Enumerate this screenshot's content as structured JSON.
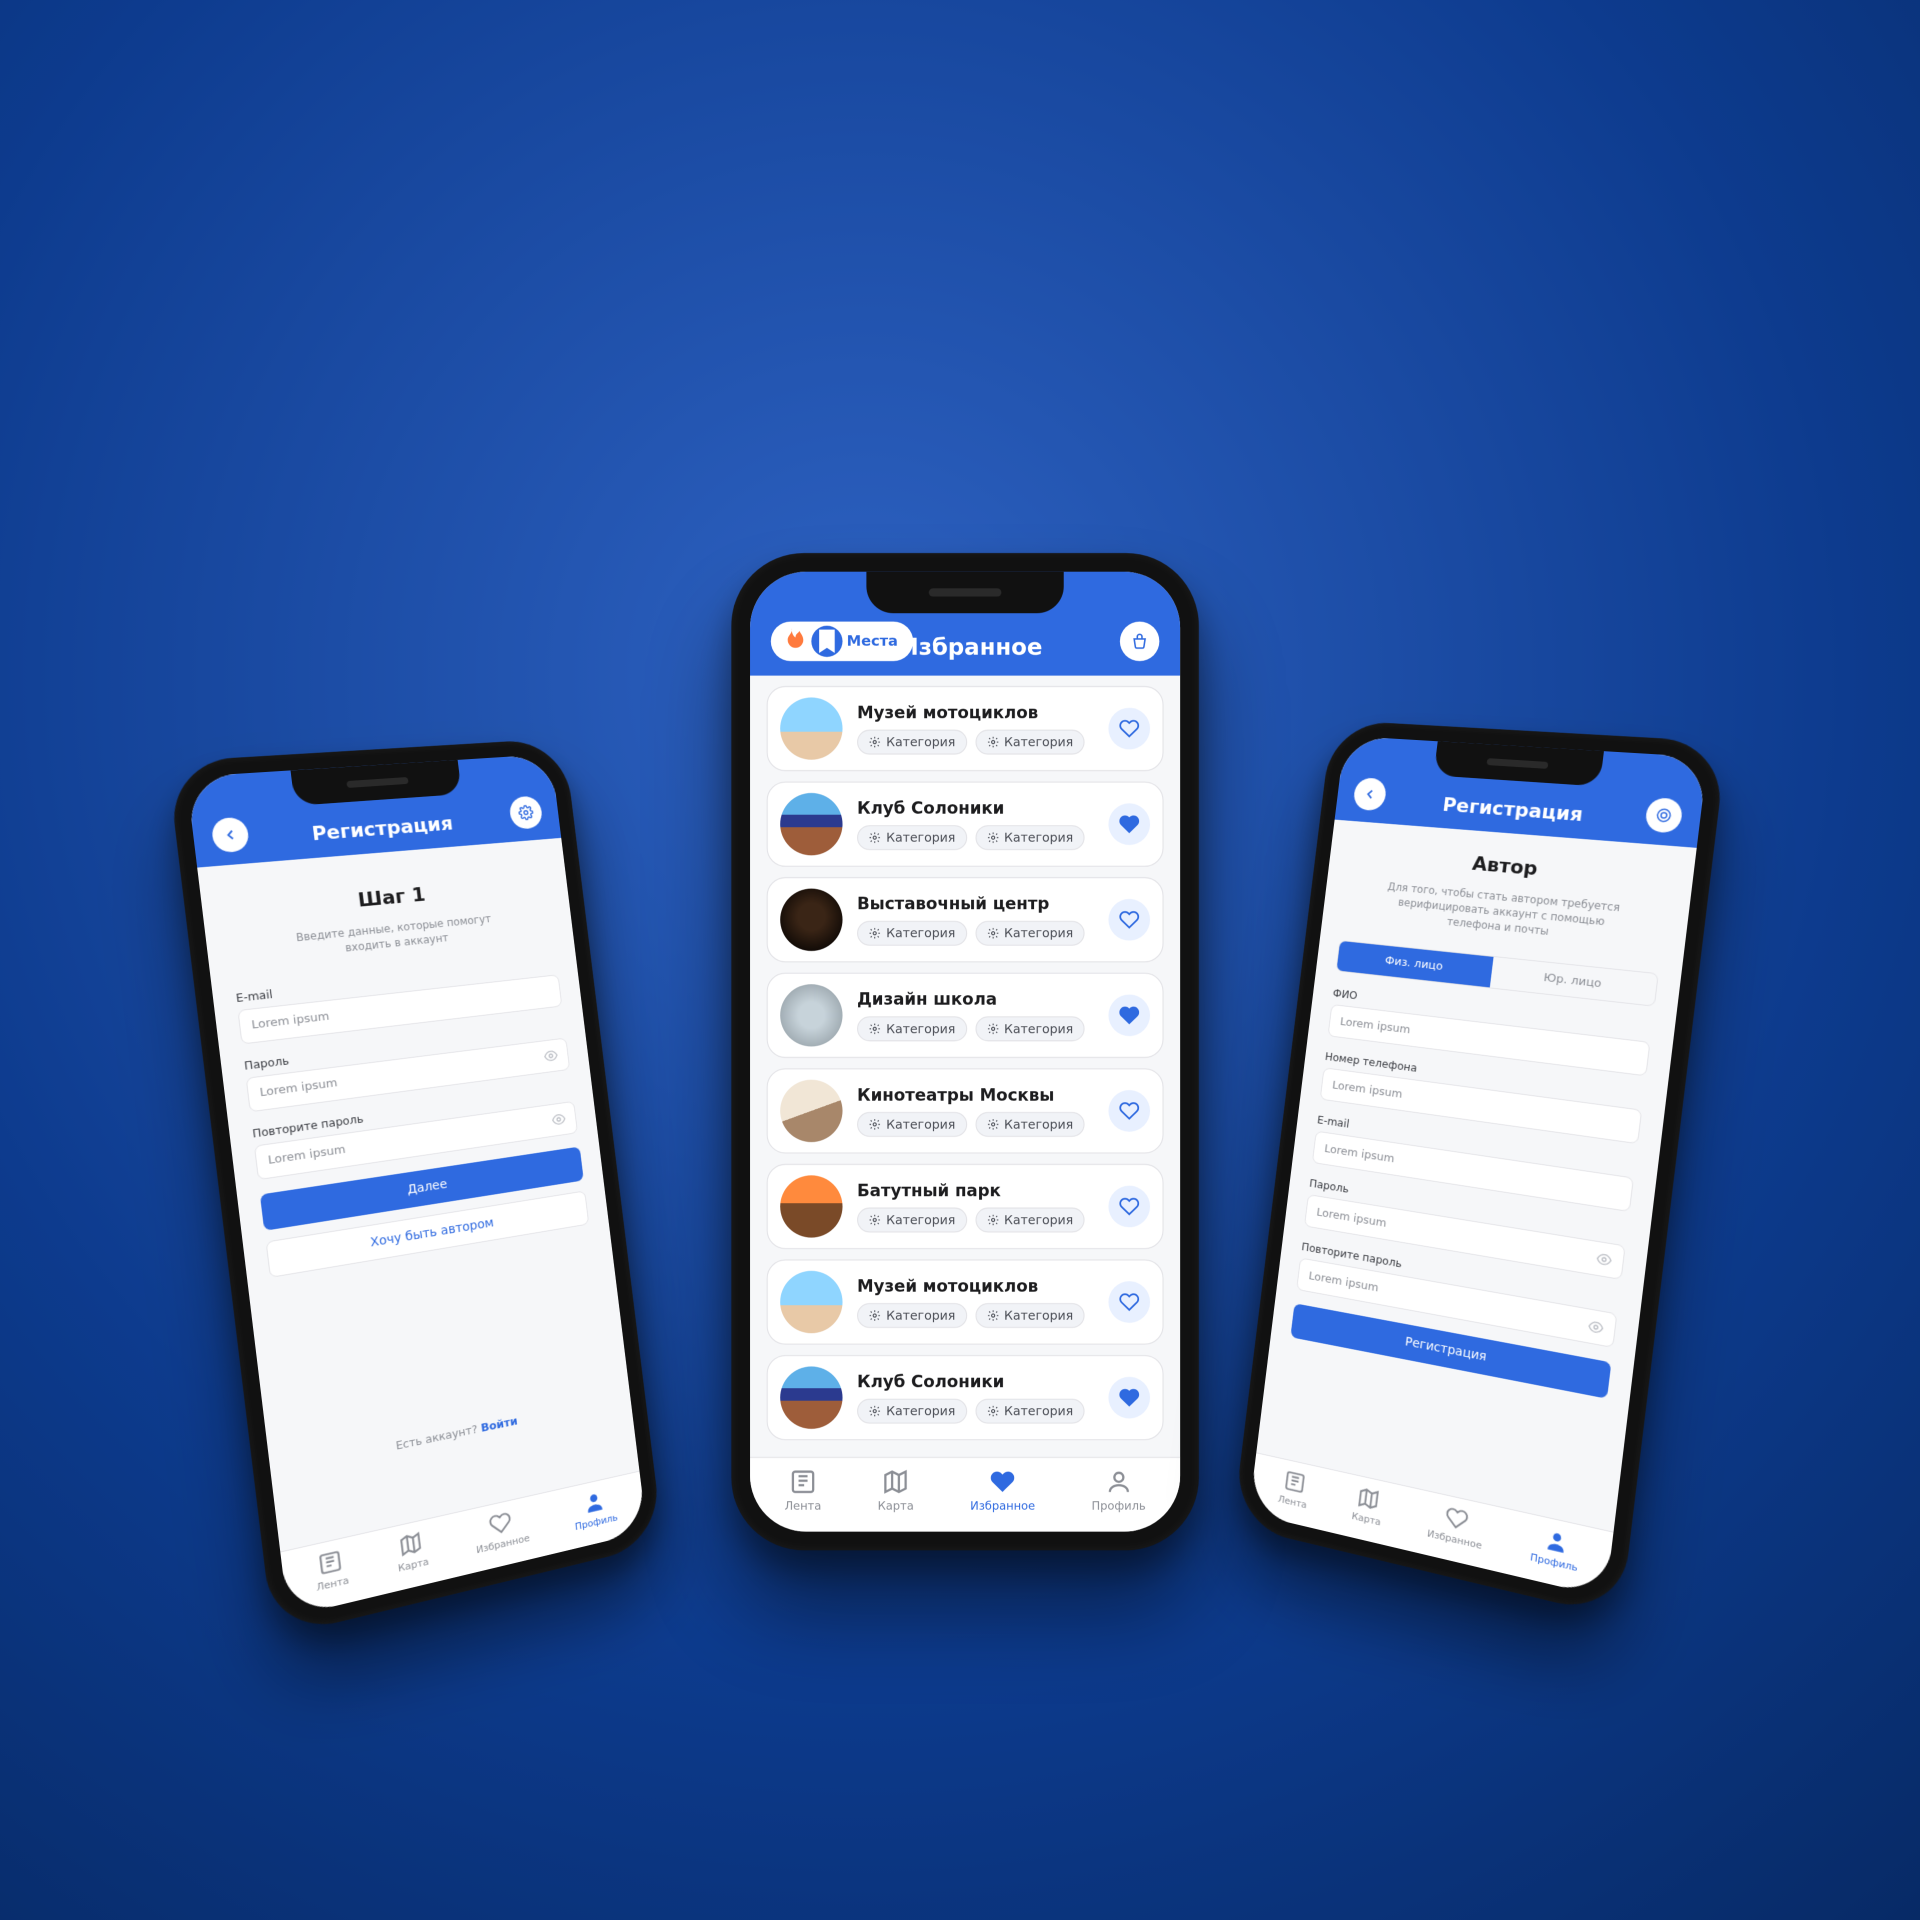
{
  "nav": {
    "feed": "Лента",
    "map": "Карта",
    "fav": "Избранное",
    "profile": "Профиль"
  },
  "left": {
    "appbar_title": "Регистрация",
    "step_title": "Шаг 1",
    "step_sub": "Введите данные, которые помогут входить в аккаунт",
    "email_label": "E-mail",
    "email_ph": "Lorem ipsum",
    "pass_label": "Пароль",
    "pass_ph": "Lorem ipsum",
    "pass2_label": "Повторите пароль",
    "pass2_ph": "Lorem ipsum",
    "next_btn": "Далее",
    "author_btn": "Хочу быть автором",
    "have_account": "Есть аккаунт? ",
    "login_link": "Войти"
  },
  "center": {
    "appbar_title": "Избранное",
    "seg_label": "Места",
    "items": [
      {
        "title": "Музей мотоциклов",
        "c1": "Категория",
        "c2": "Категория",
        "fav": false,
        "avatar": "sky"
      },
      {
        "title": "Клуб Солоники",
        "c1": "Категория",
        "c2": "Категория",
        "fav": true,
        "avatar": "church"
      },
      {
        "title": "Выставочный центр",
        "c1": "Категория",
        "c2": "Категория",
        "fav": false,
        "avatar": "warm"
      },
      {
        "title": "Дизайн школа",
        "c1": "Категория",
        "c2": "Категория",
        "fav": true,
        "avatar": "wide"
      },
      {
        "title": "Кинотеатры Москвы",
        "c1": "Категория",
        "c2": "Категория",
        "fav": false,
        "avatar": "kids"
      },
      {
        "title": "Батутный парк",
        "c1": "Категория",
        "c2": "Категория",
        "fav": false,
        "avatar": "orange"
      },
      {
        "title": "Музей мотоциклов",
        "c1": "Категория",
        "c2": "Категория",
        "fav": false,
        "avatar": "sky"
      },
      {
        "title": "Клуб Солоники",
        "c1": "Категория",
        "c2": "Категория",
        "fav": true,
        "avatar": "church"
      }
    ]
  },
  "right": {
    "appbar_title": "Регистрация",
    "heading": "Автор",
    "sub": "Для того, чтобы стать автором требуется верифицировать аккаунт с помощью телефона и почты",
    "tab_ind": "Физ. лицо",
    "tab_org": "Юр. лицо",
    "fio_label": "ФИО",
    "phone_label": "Номер телефона",
    "email_label": "E-mail",
    "pass_label": "Пароль",
    "pass2_label": "Повторите пароль",
    "ph": "Lorem ipsum",
    "submit": "Регистрация"
  }
}
